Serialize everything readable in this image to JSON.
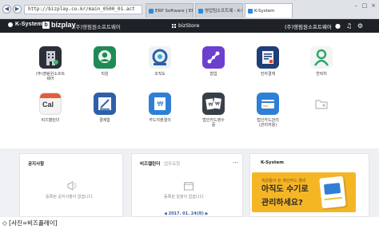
{
  "browser": {
    "url": "http://bizplay.co.kr/main_0500_01.act",
    "tabs": [
      {
        "label": "ERP Software | ERP Syst...",
        "active": false
      },
      {
        "label": "영업팀소프트웨 - K-System",
        "active": false
      },
      {
        "label": "K-System",
        "active": true
      }
    ]
  },
  "header": {
    "brand": "K-System",
    "product": "bizplay",
    "company": "(주)영림원소프트웨어",
    "store": "bizStore",
    "user": "(주)영림원소프트웨어",
    "icon_color": "#1e2227"
  },
  "apps_row1": [
    {
      "label": "(주)영림원소프트\n웨어",
      "icon": "building-icon",
      "color": "#2b3038"
    },
    {
      "label": "직원",
      "icon": "employee-icon",
      "color": "#1f8a55"
    },
    {
      "label": "조직도",
      "icon": "org-chart-icon",
      "color": "#eef2f6"
    },
    {
      "label": "협업",
      "icon": "collaboration-icon",
      "color": "#6c3fcf"
    },
    {
      "label": "전자결재",
      "icon": "approval-icon",
      "color": "#1e3f78"
    },
    {
      "label": "연락처",
      "icon": "contacts-icon",
      "color": "#f2f5f3"
    }
  ],
  "apps_row2": [
    {
      "label": "비즈캘린더",
      "icon": "calendar-icon",
      "color": "#f3f3f3",
      "badge": "Cal"
    },
    {
      "label": "결재함",
      "icon": "sign-icon",
      "color": "#2f5fa8"
    },
    {
      "label": "카드지출결의",
      "icon": "card-expense-icon",
      "color": "#2e7fd6"
    },
    {
      "label": "법인카드영수\n증",
      "icon": "receipt-icon",
      "color": "#374049"
    },
    {
      "label": "법인카드관리\n(관리자용)",
      "icon": "card-admin-icon",
      "color": "#2e7fd6"
    },
    {
      "label": "",
      "icon": "add-folder-icon",
      "color": "#ffffff"
    }
  ],
  "widgets": {
    "notice": {
      "title": "공지사항",
      "empty": "등록된 공지사항이 없습니다."
    },
    "schedule": {
      "title": "비즈캘린더",
      "subtitle": "업무요청",
      "empty": "등록된 일정이 없습니다.",
      "date": "◀ 2017. 01. 24(화) ▶"
    },
    "ksystem": {
      "title": "K-System",
      "promo_line1": "직원들이 쓴 개인카드 경비",
      "promo_line2": "아직도 수기로",
      "promo_line3": "관리하세요?",
      "promo_color": "#f5b626"
    }
  },
  "caption": "◇ [사진=비즈플레이]"
}
